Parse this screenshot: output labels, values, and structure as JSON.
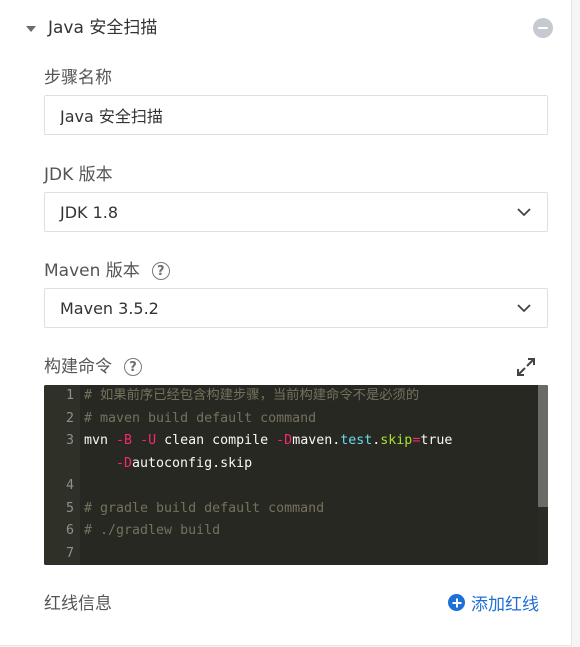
{
  "header": {
    "title": "Java 安全扫描"
  },
  "form": {
    "step_name_label": "步骤名称",
    "step_name_value": "Java 安全扫描",
    "jdk_label": "JDK 版本",
    "jdk_value": "JDK 1.8",
    "maven_label": "Maven 版本",
    "maven_value": "Maven 3.5.2",
    "build_cmd_label": "构建命令",
    "help_glyph": "?"
  },
  "editor": {
    "line_numbers": [
      "1",
      "2",
      "3",
      "",
      "4",
      "5",
      "6",
      "7"
    ],
    "line1": "# 如果前序已经包含构建步骤，当前构建命令不是必须的",
    "line2": "# maven build default command",
    "line3_parts": [
      "mvn ",
      "-B",
      " ",
      "-U",
      " clean compile ",
      "-D",
      "maven",
      ".",
      "test",
      ".",
      "skip",
      "=",
      "true"
    ],
    "line3_wrap_parts": [
      "-D",
      "autoconfig",
      ".",
      "skip"
    ],
    "line5": "# gradle build default command",
    "line6": "# ./gradlew build"
  },
  "footer": {
    "redline_label": "红线信息",
    "add_redline_label": "添加红线"
  },
  "icons": {
    "caret": "caret-down-icon",
    "collapse": "minus-circle-icon",
    "help": "question-circle-icon",
    "chevron": "chevron-down-icon",
    "expand": "expand-icon",
    "add": "plus-circle-icon"
  },
  "colors": {
    "accent": "#1f6fd8",
    "editor_bg": "#272822"
  }
}
